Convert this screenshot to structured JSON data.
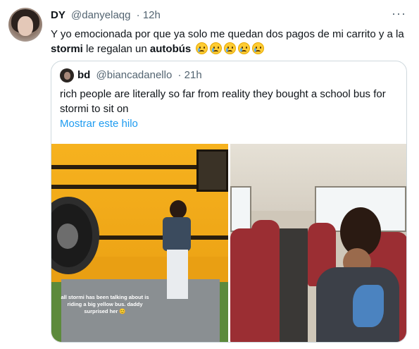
{
  "tweet": {
    "display_name": "DY",
    "handle": "@danyelaqg",
    "time": "· 12h",
    "more_icon": "more-horizontal-icon",
    "text_before": "Y yo emocionada por que ya solo me quedan dos pagos de mi carrito y a la ",
    "text_bold_1": "stormi",
    "text_middle": " le regalan un ",
    "text_bold_2": "autobús",
    "emoji_name": "crying-face-emoji",
    "emoji_count": 5
  },
  "quoted": {
    "display_name": "bd",
    "handle": "@biancadanello",
    "time": "· 21h",
    "text": "rich people are literally so far from reality they bought a school bus for stormi to sit on",
    "show_thread": "Mostrar este hilo",
    "image_caption": "all stormi has been talking about is riding a big yellow bus. daddy surprised her 😊"
  },
  "colors": {
    "link": "#1d9bf0",
    "secondary_text": "#536471",
    "border": "#cfd9de"
  }
}
